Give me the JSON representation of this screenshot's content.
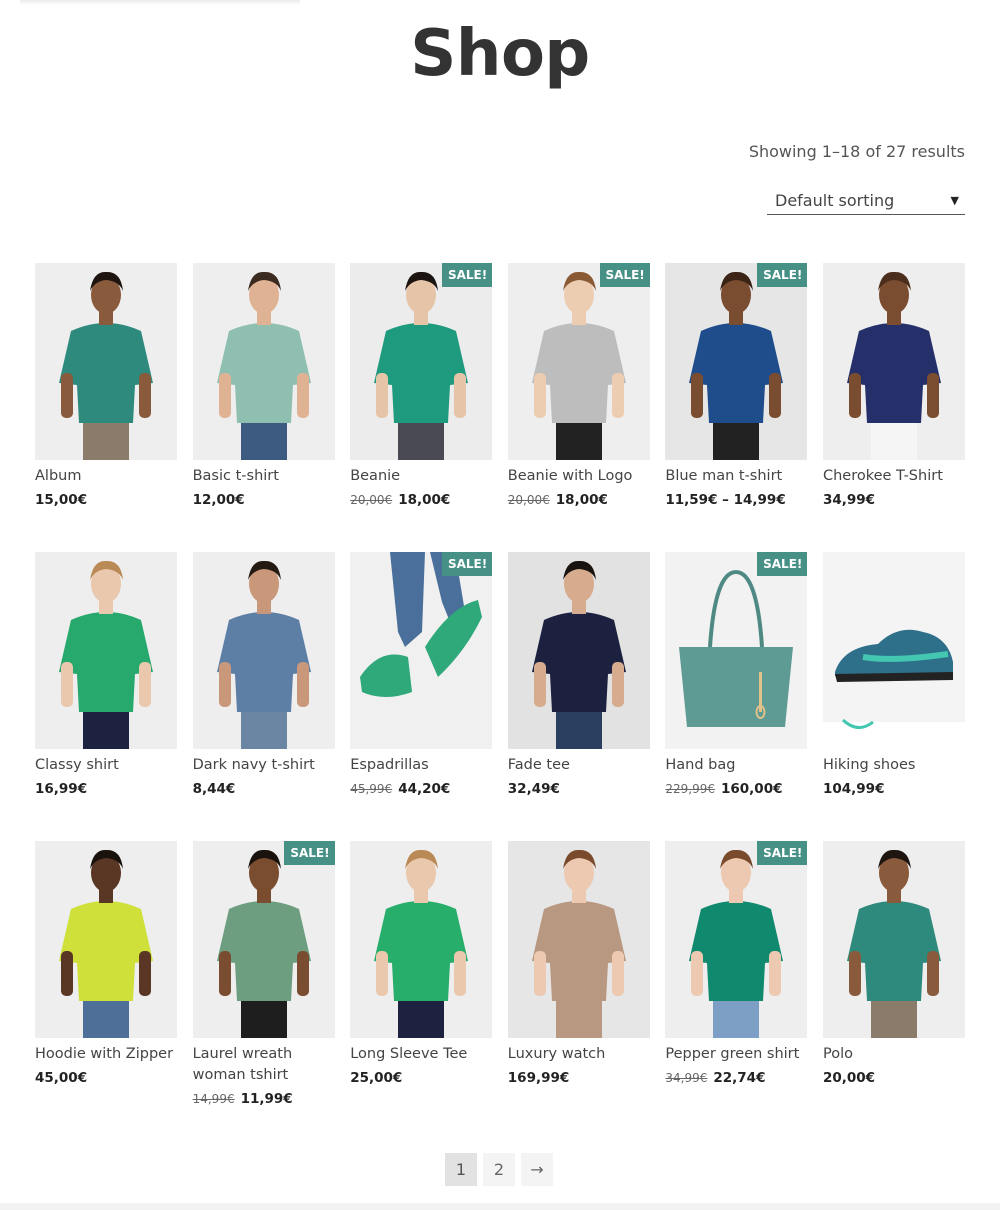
{
  "page": {
    "title": "Shop",
    "result_count": "Showing 1–18 of 27 results",
    "sorting": {
      "selected": "Default sorting"
    }
  },
  "colors": {
    "sale_badge": "#479086"
  },
  "sale_label": "SALE!",
  "products": [
    {
      "name": "Album",
      "price": "15,00€",
      "sale": false,
      "bg": "#eeeeee",
      "shirt": "#2e8a7c",
      "skin": "#8a5a3c",
      "hair": "#1e1510",
      "pants": "#8b7b6b",
      "kind": "person"
    },
    {
      "name": "Basic t-shirt",
      "price": "12,00€",
      "sale": false,
      "bg": "#eeeeee",
      "shirt": "#8fbfb0",
      "skin": "#e0b294",
      "hair": "#3a2a1f",
      "pants": "#3d5a80",
      "kind": "person"
    },
    {
      "name": "Beanie",
      "old_price": "20,00€",
      "price": "18,00€",
      "sale": true,
      "bg": "#ececec",
      "shirt": "#1e9a7e",
      "skin": "#e6c4a8",
      "hair": "#1c1410",
      "pants": "#4a4a55",
      "kind": "person"
    },
    {
      "name": "Beanie with Logo",
      "old_price": "20,00€",
      "price": "18,00€",
      "sale": true,
      "bg": "#eeeeee",
      "shirt": "#bdbdbd",
      "skin": "#edcdb2",
      "hair": "#8a5a35",
      "pants": "#222222",
      "kind": "person"
    },
    {
      "name": "Blue man t-shirt",
      "price": "11,59€ – 14,99€",
      "sale": true,
      "bg": "#e6e6e6",
      "shirt": "#1f4d8c",
      "skin": "#7a4c30",
      "hair": "#3b2415",
      "pants": "#222222",
      "kind": "person"
    },
    {
      "name": "Cherokee T-Shirt",
      "price": "34,99€",
      "sale": false,
      "bg": "#eeeeee",
      "shirt": "#25306a",
      "skin": "#7a4c30",
      "hair": "#4a2d1a",
      "pants": "#f5f5f5",
      "kind": "person"
    },
    {
      "name": "Classy shirt",
      "price": "16,99€",
      "sale": false,
      "bg": "#eeeeee",
      "shirt": "#27a86c",
      "skin": "#eac8ad",
      "hair": "#b98a56",
      "pants": "#1c2240",
      "kind": "person"
    },
    {
      "name": "Dark navy t-shirt",
      "price": "8,44€",
      "sale": false,
      "bg": "#eeeeee",
      "shirt": "#5d7fa6",
      "skin": "#c9977a",
      "hair": "#241a14",
      "pants": "#6a86a3",
      "kind": "person"
    },
    {
      "name": "Espadrillas",
      "old_price": "45,99€",
      "price": "44,20€",
      "sale": true,
      "bg": "#f0f0f0",
      "shirt": "#2fa87a",
      "skin": "#e8c9b0",
      "hair": "#4a6f9a",
      "pants": "#4a6f9a",
      "kind": "shoes"
    },
    {
      "name": "Fade tee",
      "price": "32,49€",
      "sale": false,
      "bg": "#e2e2e2",
      "shirt": "#1c2140",
      "skin": "#d7ab8e",
      "hair": "#1a1410",
      "pants": "#2a3f5f",
      "kind": "person"
    },
    {
      "name": "Hand bag",
      "old_price": "229,99€",
      "price": "160,00€",
      "sale": true,
      "bg": "#f2f2f2",
      "shirt": "#5e9b94",
      "skin": "#e0c28a",
      "hair": "#333333",
      "pants": "#333333",
      "kind": "bag"
    },
    {
      "name": "Hiking shoes",
      "price": "104,99€",
      "sale": false,
      "bg": "#f4f4f4",
      "shirt": "#2e6f8a",
      "skin": "#44c7b0",
      "hair": "#222222",
      "pants": "#222222",
      "kind": "sneaker"
    },
    {
      "name": "Hoodie with Zipper",
      "price": "45,00€",
      "sale": false,
      "bg": "#eeeeee",
      "shirt": "#cfe03a",
      "skin": "#5a3624",
      "hair": "#1a120c",
      "pants": "#4d6f98",
      "kind": "person"
    },
    {
      "name": "Laurel wreath woman tshirt",
      "old_price": "14,99€",
      "price": "11,99€",
      "sale": true,
      "bg": "#eeeeee",
      "shirt": "#6e9e80",
      "skin": "#7a4c30",
      "hair": "#1a120c",
      "pants": "#1e1e1e",
      "kind": "person"
    },
    {
      "name": "Long Sleeve Tee",
      "price": "25,00€",
      "sale": false,
      "bg": "#eeeeee",
      "shirt": "#27ae6a",
      "skin": "#eac8ad",
      "hair": "#b98a56",
      "pants": "#1c2240",
      "kind": "person"
    },
    {
      "name": "Luxury watch",
      "price": "169,99€",
      "sale": false,
      "bg": "#e6e6e6",
      "shirt": "#b89880",
      "skin": "#ecc9b0",
      "hair": "#7a4a2c",
      "pants": "#b89880",
      "kind": "person"
    },
    {
      "name": "Pepper green shirt",
      "old_price": "34,99€",
      "price": "22,74€",
      "sale": true,
      "bg": "#eeeeee",
      "shirt": "#0f8a6e",
      "skin": "#ecc9b0",
      "hair": "#7a4a2c",
      "pants": "#7d9fc6",
      "kind": "person"
    },
    {
      "name": "Polo",
      "price": "20,00€",
      "sale": false,
      "bg": "#eeeeee",
      "shirt": "#2e8a7c",
      "skin": "#8a5a3c",
      "hair": "#1e1510",
      "pants": "#8b7b6b",
      "kind": "person"
    }
  ],
  "pagination": {
    "pages": [
      "1",
      "2"
    ],
    "current": "1",
    "next": "→"
  }
}
